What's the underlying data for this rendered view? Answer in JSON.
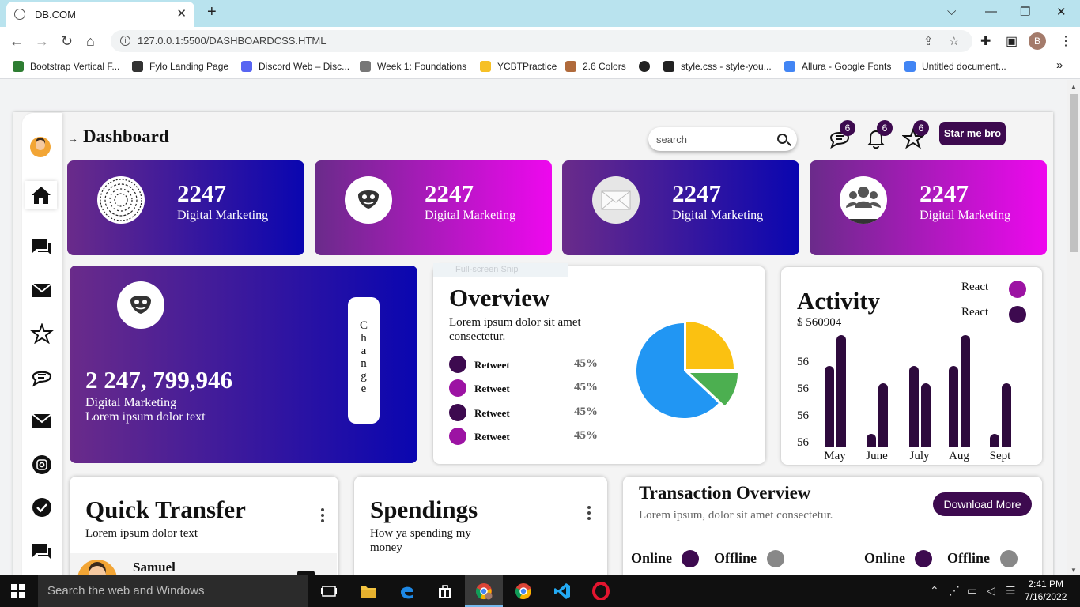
{
  "browser": {
    "tab_title": "DB.COM",
    "tab_close": "✕",
    "new_tab": "+",
    "url": "127.0.0.1:5500/DASHBOARDCSS.HTML",
    "profile_initial": "B",
    "bookmarks": [
      {
        "label": "Bootstrap Vertical F...",
        "color": "#2e7d32"
      },
      {
        "label": "Fylo Landing Page",
        "color": "#333333"
      },
      {
        "label": "Discord Web – Disc...",
        "color": "#5865f2"
      },
      {
        "label": "Week 1: Foundations",
        "color": "#555555"
      },
      {
        "label": "YCBTPractice",
        "color": "#f6c026"
      },
      {
        "label": "2.6 Colors",
        "color": "#b06a3b"
      },
      {
        "label": "",
        "color": "#222222"
      },
      {
        "label": "style.css - style-you...",
        "color": "#222222"
      },
      {
        "label": "Allura - Google Fonts",
        "color": "#4285f4"
      },
      {
        "label": "Untitled document...",
        "color": "#4285f4"
      }
    ],
    "more_bookmarks": "»"
  },
  "dashboard": {
    "title": "Dashboard",
    "title_arrow": "→",
    "search_placeholder": "search",
    "badges": {
      "messages": "6",
      "notifications": "6",
      "stars": "6"
    },
    "star_button": "Star me bro",
    "stat_cards": [
      {
        "value": "2247",
        "label": "Digital Marketing",
        "icon": "spiral-icon",
        "gradient": "purple-blue"
      },
      {
        "value": "2247",
        "label": "Digital Marketing",
        "icon": "robot-face-icon",
        "gradient": "purple-magenta"
      },
      {
        "value": "2247",
        "label": "Digital Marketing",
        "icon": "envelope-icon",
        "gradient": "purple-blue"
      },
      {
        "value": "2247",
        "label": "Digital Marketing",
        "icon": "group-icon",
        "gradient": "purple-magenta"
      }
    ],
    "big_card": {
      "value": "2 247, 799,946",
      "line1": "Digital Marketing",
      "line2": "Lorem ipsum dolor text",
      "change_label": "C h a n g e"
    },
    "overview": {
      "title": "Overview",
      "subtitle": "Lorem ipsum dolor sit amet consectetur.",
      "rows": [
        {
          "label": "Retweet",
          "pct": "45%",
          "color": "#3d0a4f"
        },
        {
          "label": "Retweet",
          "pct": "45%",
          "color": "#9c13a3"
        },
        {
          "label": "Retweet",
          "pct": "45%",
          "color": "#3d0a4f"
        },
        {
          "label": "Retweet",
          "pct": "45%",
          "color": "#9c13a3"
        }
      ]
    },
    "activity": {
      "title": "Activity",
      "amount": "$ 560904",
      "legend": [
        {
          "label": "React",
          "color": "#9c13a3"
        },
        {
          "label": "React",
          "color": "#3d0a4f"
        }
      ]
    },
    "quick_transfer": {
      "title": "Quick Transfer",
      "subtitle": "Lorem ipsum dolor text",
      "row_name": "Samuel"
    },
    "spendings": {
      "title": "Spendings",
      "subtitle": "How ya spending my money"
    },
    "transactions": {
      "title": "Transaction Overview",
      "subtitle": "Lorem ipsum, dolor sit amet consectetur.",
      "download_button": "Download More",
      "status": [
        {
          "label": "Online",
          "color": "#3d0a4f"
        },
        {
          "label": "Offline",
          "color": "#888888"
        },
        {
          "label": "Online",
          "color": "#3d0a4f"
        },
        {
          "label": "Offline",
          "color": "#888888"
        }
      ]
    },
    "snip_overlay": "Full-screen Snip"
  },
  "chart_data": [
    {
      "type": "pie",
      "labels": [],
      "values": [
        25,
        12,
        63
      ],
      "colors": [
        "#fbc111",
        "#4caf50",
        "#2196f3"
      ]
    },
    {
      "type": "bar",
      "categories": [
        "May",
        "June",
        "July",
        "Aug",
        "Sept"
      ],
      "ytick_labels": [
        "56",
        "56",
        "56",
        "56"
      ],
      "series": [
        {
          "values": [
            72,
            11,
            72,
            72,
            11
          ]
        },
        {
          "values": [
            100,
            57,
            57,
            100,
            57
          ]
        }
      ],
      "ylim": [
        0,
        100
      ]
    }
  ],
  "taskbar": {
    "search_placeholder": "Search the web and Windows",
    "time": "2:41 PM",
    "date": "7/16/2022"
  }
}
